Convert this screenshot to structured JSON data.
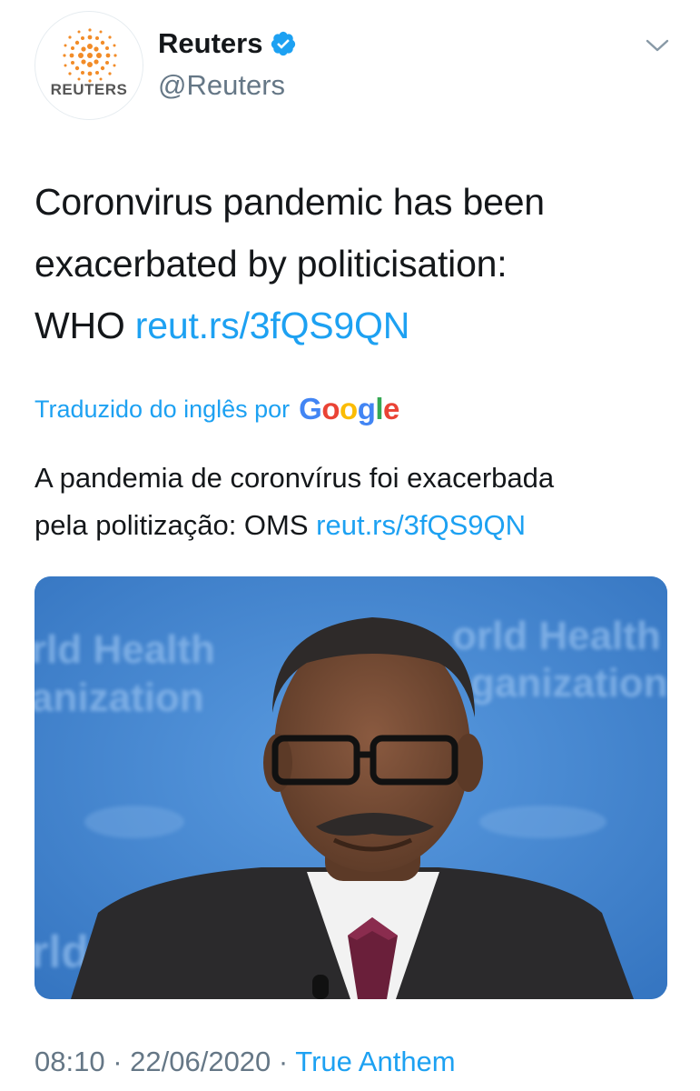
{
  "account": {
    "display_name": "Reuters",
    "handle": "@Reuters",
    "avatar_text": "REUTERS",
    "verified": true
  },
  "tweet": {
    "text_line1": "Coronvirus pandemic has been",
    "text_line2": "exacerbated by politicisation:",
    "text_line3": "WHO ",
    "link": "reut.rs/3fQS9QN"
  },
  "translation": {
    "label": "Traduzido do inglês por",
    "provider": "Google",
    "text_part1": "A pandemia de coronvírus foi exacerbada",
    "text_part2": "pela politização: OMS ",
    "link": "reut.rs/3fQS9QN"
  },
  "media": {
    "backdrop_text_left": "rld Health",
    "backdrop_text_left2": "anization",
    "backdrop_text_right": "orld Health",
    "backdrop_text_right2": "ganization",
    "backdrop_text_bottom": "rld"
  },
  "meta": {
    "time": "08:10",
    "separator": " · ",
    "date": "22/06/2020",
    "source": "True Anthem"
  },
  "colors": {
    "link": "#1da1f2",
    "muted": "#657786",
    "verified": "#1da1f2",
    "brand_orange": "#f28c28"
  },
  "icons": [
    "reuters-logo-icon",
    "verified-badge-icon",
    "chevron-down-icon"
  ]
}
